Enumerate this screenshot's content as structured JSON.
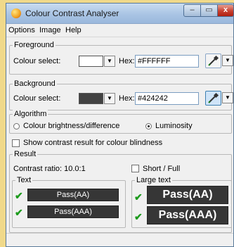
{
  "window": {
    "title": "Colour Contrast Analyser"
  },
  "title_controls": {
    "minimize": "–",
    "maximize": "▭",
    "close": "x"
  },
  "menu": [
    {
      "label": "Options"
    },
    {
      "label": "Image"
    },
    {
      "label": "Help"
    }
  ],
  "foreground": {
    "group_label": "Foreground",
    "colour_select_label": "Colour select:",
    "hex_label": "Hex:",
    "hex_value": "#FFFFFF",
    "swatch_color": "#FFFFFF"
  },
  "background": {
    "group_label": "Background",
    "colour_select_label": "Colour select:",
    "hex_label": "Hex:",
    "hex_value": "#424242",
    "swatch_color": "#424242"
  },
  "algorithm": {
    "group_label": "Algorithm",
    "options": [
      {
        "label": "Colour brightness/difference",
        "selected": false
      },
      {
        "label": "Luminosity",
        "selected": true
      }
    ]
  },
  "colour_blindness": {
    "label": "Show contrast result for colour blindness",
    "checked": false
  },
  "result": {
    "group_label": "Result",
    "contrast_ratio": "Contrast ratio: 10.0:1",
    "short_full": {
      "label": "Short / Full",
      "checked": false
    },
    "text": {
      "group_label": "Text",
      "aa": "Pass(AA)",
      "aaa": "Pass(AAA)"
    },
    "large_text": {
      "group_label": "Large text",
      "aa": "Pass(AA)",
      "aaa": "Pass(AAA)"
    },
    "tick": "✔"
  },
  "icons": {
    "dropdown": "▼",
    "eyedropper": "eyedropper-icon"
  }
}
